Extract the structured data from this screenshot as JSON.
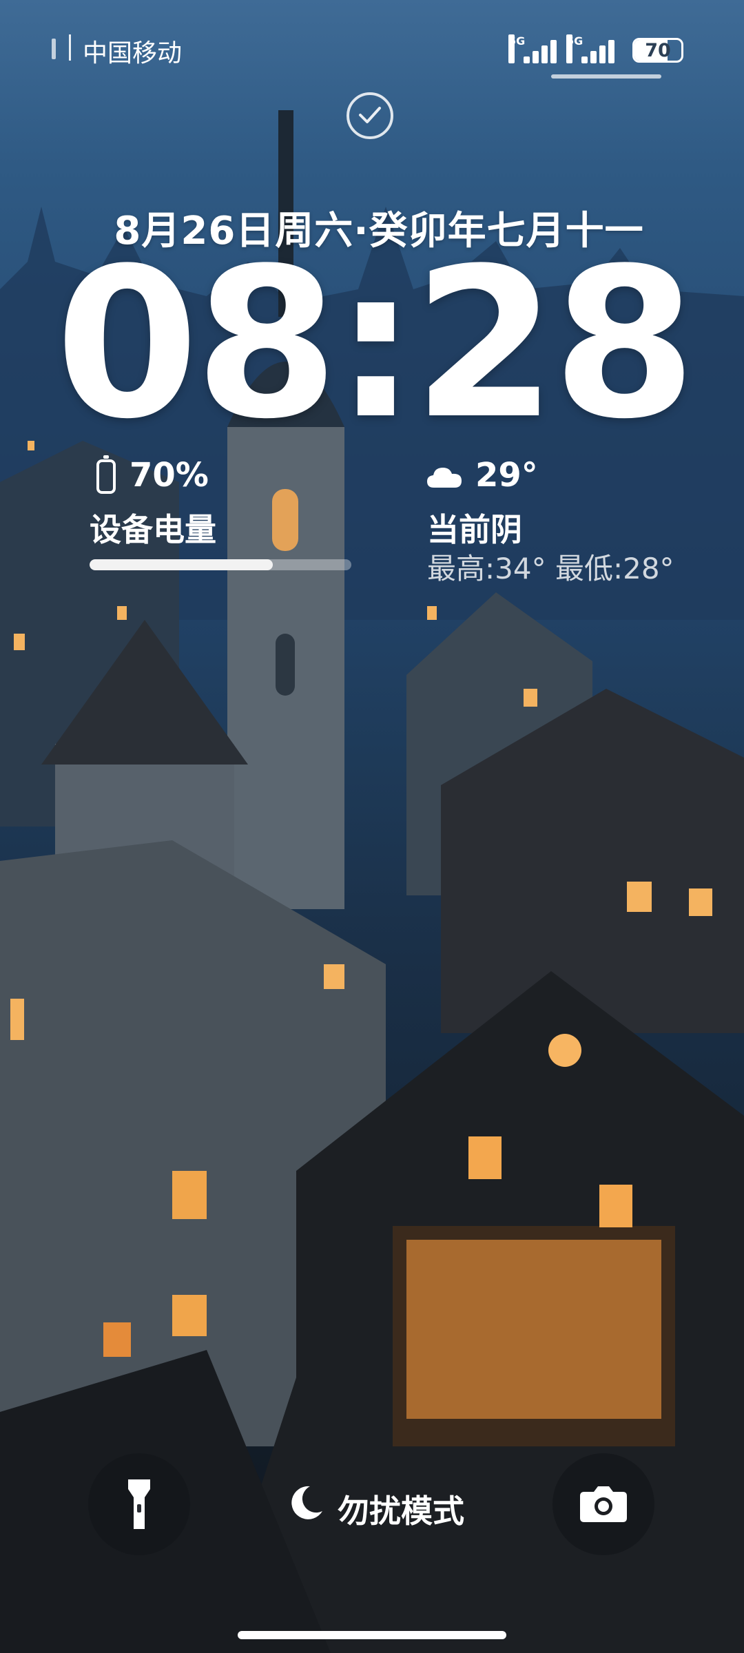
{
  "status_bar": {
    "carrier": "中国移动",
    "signal_1_label": "5G",
    "signal_2_label": "5G",
    "battery_level": 70,
    "battery_text": "70"
  },
  "lock": {
    "date": "8月26日周六·癸卯年七月十一",
    "time": "08:28"
  },
  "battery_widget": {
    "percent": "70%",
    "label": "设备电量",
    "level": 0.7
  },
  "weather_widget": {
    "temperature": "29°",
    "condition": "当前阴",
    "range": "最高:34° 最低:28°",
    "icon": "cloud-icon"
  },
  "controls": {
    "flashlight_icon": "flashlight-icon",
    "dnd_icon": "moon-icon",
    "dnd_label": "勿扰模式",
    "camera_icon": "camera-icon"
  },
  "colors": {
    "sky_top": "#3f6b96",
    "window_glow": "#f2a94b",
    "button_bg": "#15171b"
  }
}
